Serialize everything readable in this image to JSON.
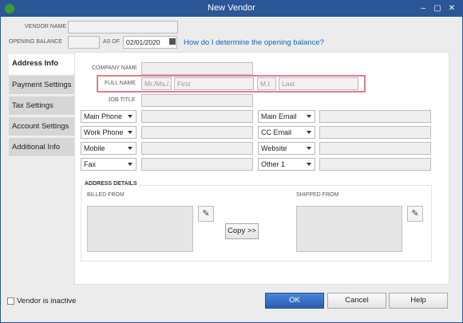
{
  "window": {
    "title": "New Vendor",
    "minimize": "–",
    "restore": "▢",
    "close": "✕"
  },
  "header": {
    "vendor_name_label": "VENDOR NAME",
    "opening_balance_label": "OPENING BALANCE",
    "as_of_label": "AS OF",
    "as_of_date": "02/01/2020",
    "help_link": "How do I determine the opening balance?"
  },
  "tabs": [
    "Address Info",
    "Payment Settings",
    "Tax Settings",
    "Account Settings",
    "Additional Info"
  ],
  "form": {
    "company_name_label": "COMPANY NAME",
    "full_name_label": "FULL NAME",
    "placeholder_prefix": "Mr./Ms./...",
    "placeholder_first": "First",
    "placeholder_mi": "M.I.",
    "placeholder_last": "Last",
    "job_title_label": "JOB TITLE"
  },
  "contact_left": [
    "Main Phone",
    "Work Phone",
    "Mobile",
    "Fax"
  ],
  "contact_right": [
    "Main Email",
    "CC Email",
    "Website",
    "Other 1"
  ],
  "address": {
    "section_title": "ADDRESS DETAILS",
    "billed_from_label": "BILLED FROM",
    "shipped_from_label": "SHIPPED FROM",
    "copy_button": "Copy >>"
  },
  "footer": {
    "inactive_label": "Vendor is inactive",
    "ok": "OK",
    "cancel": "Cancel",
    "help": "Help"
  }
}
